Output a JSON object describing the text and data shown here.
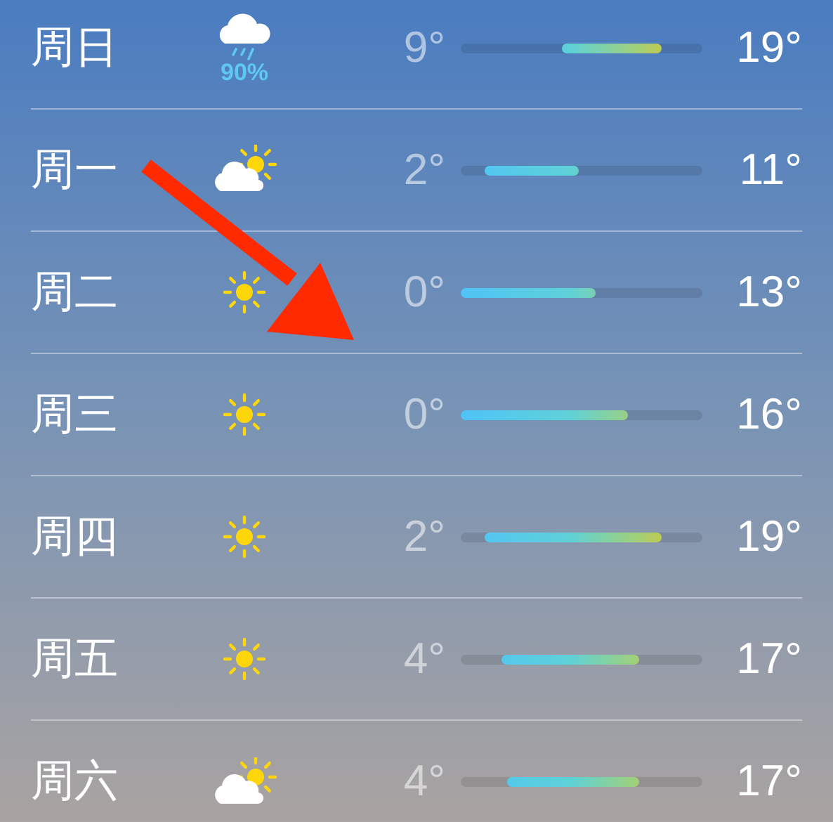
{
  "forecast": [
    {
      "day": "周日",
      "kind": "rain",
      "precip": "90%",
      "low": "9°",
      "high": "19°"
    },
    {
      "day": "周一",
      "kind": "partly-cloudy",
      "low": "2°",
      "high": "11°"
    },
    {
      "day": "周二",
      "kind": "sunny",
      "low": "0°",
      "high": "13°"
    },
    {
      "day": "周三",
      "kind": "sunny",
      "low": "0°",
      "high": "16°"
    },
    {
      "day": "周四",
      "kind": "sunny",
      "low": "2°",
      "high": "19°"
    },
    {
      "day": "周五",
      "kind": "sunny",
      "low": "4°",
      "high": "17°"
    },
    {
      "day": "周六",
      "kind": "partly-cloudy",
      "low": "4°",
      "high": "17°"
    }
  ]
}
